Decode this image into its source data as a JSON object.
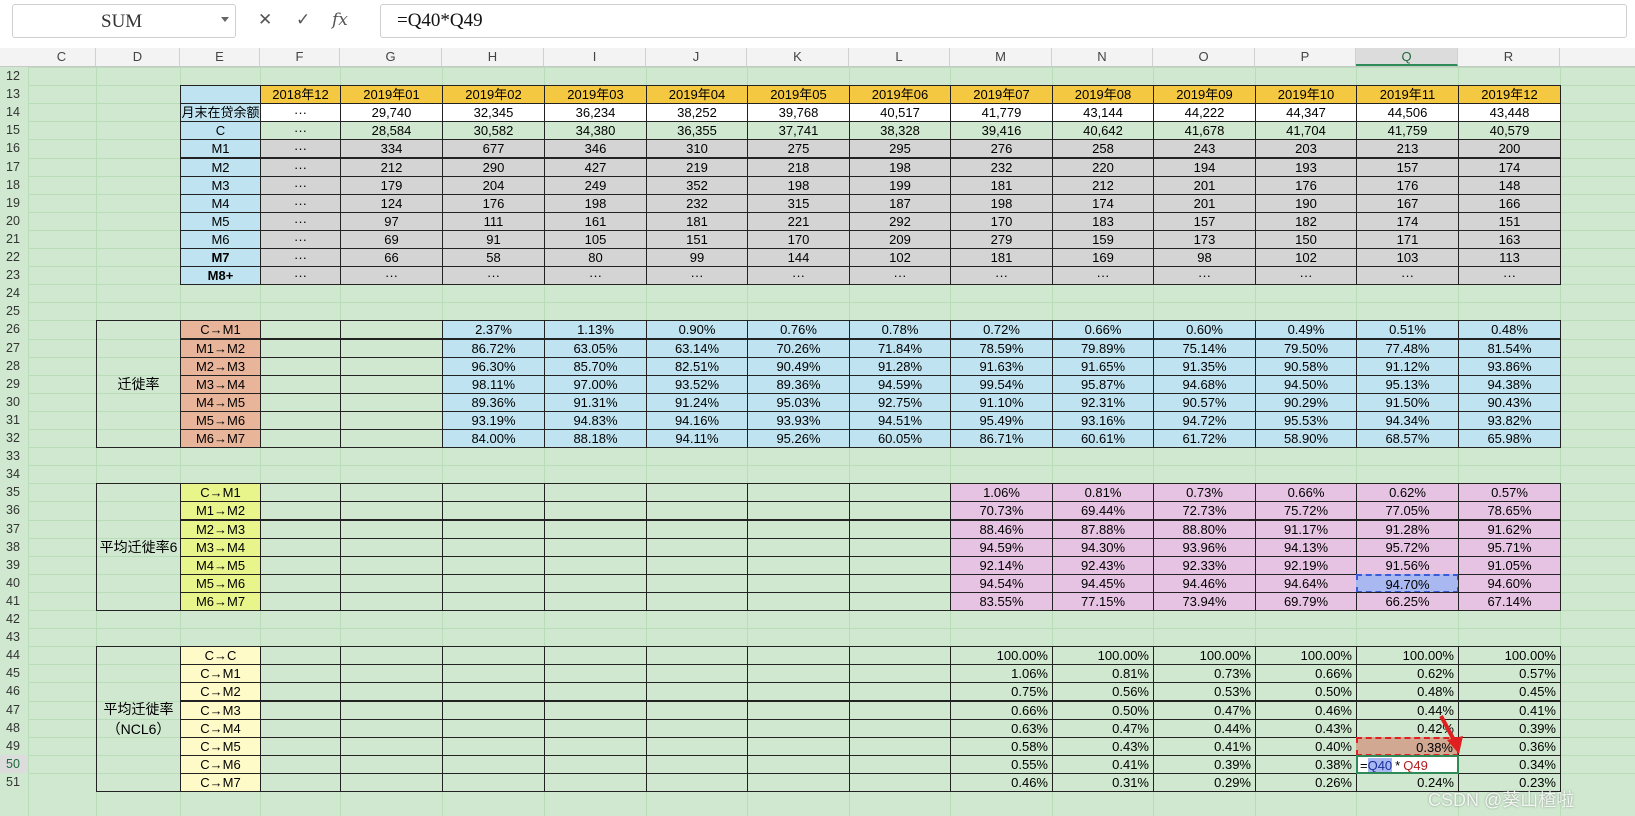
{
  "formula_bar": {
    "name_box": "SUM",
    "cancel_icon": "✕",
    "confirm_icon": "✓",
    "fx_label": "fx",
    "formula": "=Q40*Q49"
  },
  "columns": [
    "C",
    "D",
    "E",
    "F",
    "G",
    "H",
    "I",
    "J",
    "K",
    "L",
    "M",
    "N",
    "O",
    "P",
    "Q",
    "R"
  ],
  "selected_column": "Q",
  "rows": [
    12,
    13,
    14,
    15,
    16,
    17,
    18,
    19,
    20,
    21,
    22,
    23,
    24,
    25,
    26,
    27,
    28,
    29,
    30,
    31,
    32,
    33,
    34,
    35,
    36,
    37,
    38,
    39,
    40,
    41,
    42,
    43,
    44,
    45,
    46,
    47,
    48,
    49,
    50,
    51
  ],
  "selected_row": 50,
  "months": [
    "2018年12",
    "2019年01",
    "2019年02",
    "2019年03",
    "2019年04",
    "2019年05",
    "2019年06",
    "2019年07",
    "2019年08",
    "2019年09",
    "2019年10",
    "2019年11",
    "2019年12"
  ],
  "table1": {
    "rows": [
      {
        "label": "月末在贷余额",
        "values": [
          "···",
          "29,740",
          "32,345",
          "36,234",
          "38,252",
          "39,768",
          "40,517",
          "41,779",
          "43,144",
          "44,222",
          "44,347",
          "44,506",
          "43,448"
        ]
      },
      {
        "label": "C",
        "values": [
          "···",
          "28,584",
          "30,582",
          "34,380",
          "36,355",
          "37,741",
          "38,328",
          "39,416",
          "40,642",
          "41,678",
          "41,704",
          "41,759",
          "40,579"
        ]
      },
      {
        "label": "M1",
        "values": [
          "···",
          "334",
          "677",
          "346",
          "310",
          "275",
          "295",
          "276",
          "258",
          "243",
          "203",
          "213",
          "200"
        ]
      },
      {
        "label": "M2",
        "values": [
          "···",
          "212",
          "290",
          "427",
          "219",
          "218",
          "198",
          "232",
          "220",
          "194",
          "193",
          "157",
          "174"
        ]
      },
      {
        "label": "M3",
        "values": [
          "···",
          "179",
          "204",
          "249",
          "352",
          "198",
          "199",
          "181",
          "212",
          "201",
          "176",
          "176",
          "148"
        ]
      },
      {
        "label": "M4",
        "values": [
          "···",
          "124",
          "176",
          "198",
          "232",
          "315",
          "187",
          "198",
          "174",
          "201",
          "190",
          "167",
          "166"
        ]
      },
      {
        "label": "M5",
        "values": [
          "···",
          "97",
          "111",
          "161",
          "181",
          "221",
          "292",
          "170",
          "183",
          "157",
          "182",
          "174",
          "151"
        ]
      },
      {
        "label": "M6",
        "values": [
          "···",
          "69",
          "91",
          "105",
          "151",
          "170",
          "209",
          "279",
          "159",
          "173",
          "150",
          "171",
          "163"
        ]
      },
      {
        "label": "M7",
        "values": [
          "···",
          "66",
          "58",
          "80",
          "99",
          "144",
          "102",
          "181",
          "169",
          "98",
          "102",
          "103",
          "113"
        ]
      },
      {
        "label": "M8+",
        "values": [
          "···",
          "···",
          "···",
          "···",
          "···",
          "···",
          "···",
          "···",
          "···",
          "···",
          "···",
          "···",
          "···"
        ]
      }
    ]
  },
  "table2": {
    "group_label": "迁徙率",
    "rows": [
      {
        "label": "C→M1",
        "values": [
          "",
          "",
          "2.37%",
          "1.13%",
          "0.90%",
          "0.76%",
          "0.78%",
          "0.72%",
          "0.66%",
          "0.60%",
          "0.49%",
          "0.51%",
          "0.48%"
        ]
      },
      {
        "label": "M1→M2",
        "values": [
          "",
          "",
          "86.72%",
          "63.05%",
          "63.14%",
          "70.26%",
          "71.84%",
          "78.59%",
          "79.89%",
          "75.14%",
          "79.50%",
          "77.48%",
          "81.54%"
        ]
      },
      {
        "label": "M2→M3",
        "values": [
          "",
          "",
          "96.30%",
          "85.70%",
          "82.51%",
          "90.49%",
          "91.28%",
          "91.63%",
          "91.65%",
          "91.35%",
          "90.58%",
          "91.12%",
          "93.86%"
        ]
      },
      {
        "label": "M3→M4",
        "values": [
          "",
          "",
          "98.11%",
          "97.00%",
          "93.52%",
          "89.36%",
          "94.59%",
          "99.54%",
          "95.87%",
          "94.68%",
          "94.50%",
          "95.13%",
          "94.38%"
        ]
      },
      {
        "label": "M4→M5",
        "values": [
          "",
          "",
          "89.36%",
          "91.31%",
          "91.24%",
          "95.03%",
          "92.75%",
          "91.10%",
          "92.31%",
          "90.57%",
          "90.29%",
          "91.50%",
          "90.43%"
        ]
      },
      {
        "label": "M5→M6",
        "values": [
          "",
          "",
          "93.19%",
          "94.83%",
          "94.16%",
          "93.93%",
          "94.51%",
          "95.49%",
          "93.16%",
          "94.72%",
          "95.53%",
          "94.34%",
          "93.82%"
        ]
      },
      {
        "label": "M6→M7",
        "values": [
          "",
          "",
          "84.00%",
          "88.18%",
          "94.11%",
          "95.26%",
          "60.05%",
          "86.71%",
          "60.61%",
          "61.72%",
          "58.90%",
          "68.57%",
          "65.98%"
        ]
      }
    ]
  },
  "table3": {
    "group_label": "平均迁徙率6",
    "rows": [
      {
        "label": "C→M1",
        "values": [
          "",
          "",
          "",
          "",
          "",
          "",
          "",
          "1.06%",
          "0.81%",
          "0.73%",
          "0.66%",
          "0.62%",
          "0.57%"
        ]
      },
      {
        "label": "M1→M2",
        "values": [
          "",
          "",
          "",
          "",
          "",
          "",
          "",
          "70.73%",
          "69.44%",
          "72.73%",
          "75.72%",
          "77.05%",
          "78.65%"
        ]
      },
      {
        "label": "M2→M3",
        "values": [
          "",
          "",
          "",
          "",
          "",
          "",
          "",
          "88.46%",
          "87.88%",
          "88.80%",
          "91.17%",
          "91.28%",
          "91.62%"
        ]
      },
      {
        "label": "M3→M4",
        "values": [
          "",
          "",
          "",
          "",
          "",
          "",
          "",
          "94.59%",
          "94.30%",
          "93.96%",
          "94.13%",
          "95.72%",
          "95.71%"
        ]
      },
      {
        "label": "M4→M5",
        "values": [
          "",
          "",
          "",
          "",
          "",
          "",
          "",
          "92.14%",
          "92.43%",
          "92.33%",
          "92.19%",
          "91.56%",
          "91.05%"
        ]
      },
      {
        "label": "M5→M6",
        "values": [
          "",
          "",
          "",
          "",
          "",
          "",
          "",
          "94.54%",
          "94.45%",
          "94.46%",
          "94.64%",
          "94.70%",
          "94.60%"
        ]
      },
      {
        "label": "M6→M7",
        "values": [
          "",
          "",
          "",
          "",
          "",
          "",
          "",
          "83.55%",
          "77.15%",
          "73.94%",
          "69.79%",
          "66.25%",
          "67.14%"
        ]
      }
    ]
  },
  "table4": {
    "group_label": "平均迁徙率",
    "group_sublabel": "（NCL6）",
    "rows": [
      {
        "label": "C→C",
        "values": [
          "",
          "",
          "",
          "",
          "",
          "",
          "",
          "100.00%",
          "100.00%",
          "100.00%",
          "100.00%",
          "100.00%",
          "100.00%"
        ]
      },
      {
        "label": "C→M1",
        "values": [
          "",
          "",
          "",
          "",
          "",
          "",
          "",
          "1.06%",
          "0.81%",
          "0.73%",
          "0.66%",
          "0.62%",
          "0.57%"
        ]
      },
      {
        "label": "C→M2",
        "values": [
          "",
          "",
          "",
          "",
          "",
          "",
          "",
          "0.75%",
          "0.56%",
          "0.53%",
          "0.50%",
          "0.48%",
          "0.45%"
        ]
      },
      {
        "label": "C→M3",
        "values": [
          "",
          "",
          "",
          "",
          "",
          "",
          "",
          "0.66%",
          "0.50%",
          "0.47%",
          "0.46%",
          "0.44%",
          "0.41%"
        ]
      },
      {
        "label": "C→M4",
        "values": [
          "",
          "",
          "",
          "",
          "",
          "",
          "",
          "0.63%",
          "0.47%",
          "0.44%",
          "0.43%",
          "0.42%",
          "0.39%"
        ]
      },
      {
        "label": "C→M5",
        "values": [
          "",
          "",
          "",
          "",
          "",
          "",
          "",
          "0.58%",
          "0.43%",
          "0.41%",
          "0.40%",
          "0.38%",
          "0.36%"
        ]
      },
      {
        "label": "C→M6",
        "values": [
          "",
          "",
          "",
          "",
          "",
          "",
          "",
          "0.55%",
          "0.41%",
          "0.39%",
          "0.38%",
          "",
          "0.34%"
        ]
      },
      {
        "label": "C→M7",
        "values": [
          "",
          "",
          "",
          "",
          "",
          "",
          "",
          "0.46%",
          "0.31%",
          "0.29%",
          "0.26%",
          "0.24%",
          "0.23%"
        ]
      }
    ]
  },
  "edit_cell": {
    "ref1": "Q40",
    "op": "*",
    "ref2": "Q49",
    "prefix": "="
  },
  "watermark": "CSDN @葵山楂啦",
  "colors": {
    "sheet_bg": "#cfe8cf",
    "header_yellow": "#f5c842",
    "cell_gray": "#d4d4d4",
    "label_blue": "#bfe3f0",
    "label_orange": "#e8b49a",
    "label_lime": "#e8f58a",
    "label_lightyellow": "#fffbc8",
    "pink": "#e6c3e2",
    "value_blue": "#bfe3f0",
    "selection_blue": "#a9b8f0",
    "highlight_tan": "#d1a891",
    "arrow_red": "#e02020"
  }
}
